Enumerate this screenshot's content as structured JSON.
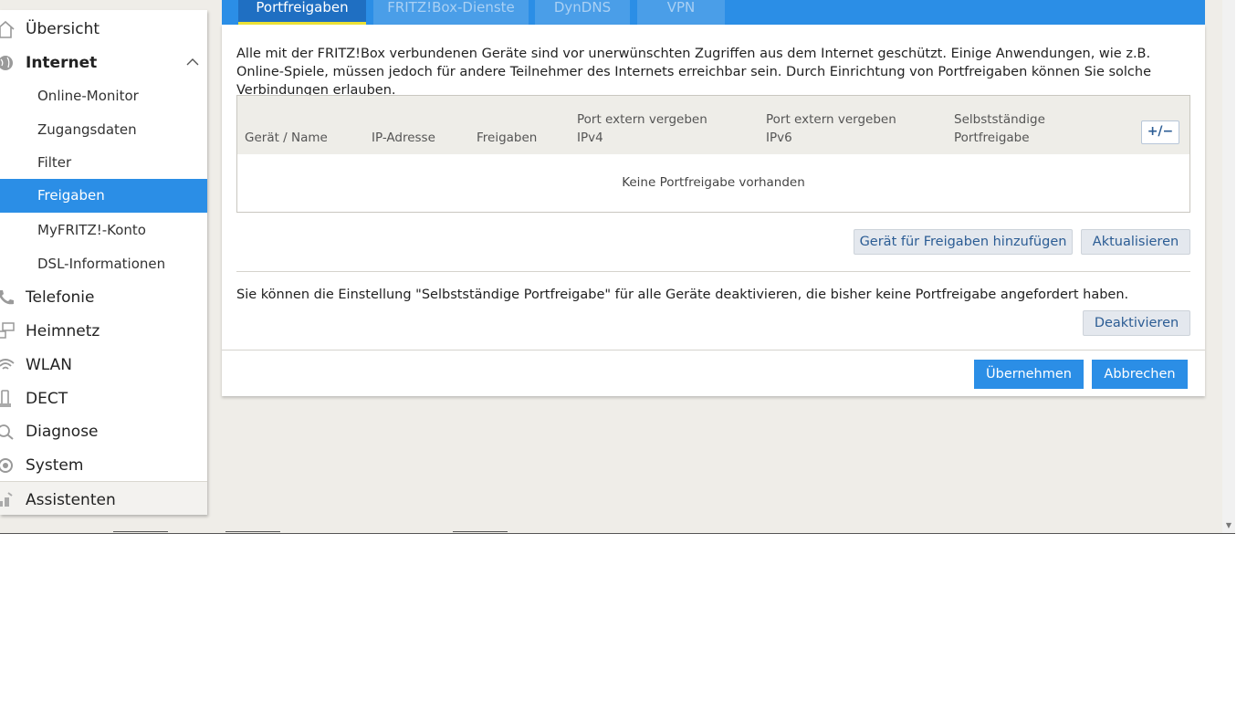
{
  "sidebar": {
    "items": [
      {
        "label": "Übersicht",
        "icon": "home-icon"
      },
      {
        "label": "Internet",
        "icon": "globe-icon",
        "expanded": true
      },
      {
        "label": "Online-Monitor"
      },
      {
        "label": "Zugangsdaten"
      },
      {
        "label": "Filter"
      },
      {
        "label": "Freigaben",
        "active": true
      },
      {
        "label": "MyFRITZ!-Konto"
      },
      {
        "label": "DSL-Informationen"
      },
      {
        "label": "Telefonie",
        "icon": "phone-icon"
      },
      {
        "label": "Heimnetz",
        "icon": "network-icon"
      },
      {
        "label": "WLAN",
        "icon": "wifi-icon"
      },
      {
        "label": "DECT",
        "icon": "dect-phone-icon"
      },
      {
        "label": "Diagnose",
        "icon": "diagnose-icon"
      },
      {
        "label": "System",
        "icon": "system-icon"
      },
      {
        "label": "Assistenten",
        "icon": "wizard-icon"
      }
    ]
  },
  "tabs": [
    {
      "label": "Portfreigaben",
      "active": true
    },
    {
      "label": "FRITZ!Box-Dienste"
    },
    {
      "label": "DynDNS"
    },
    {
      "label": "VPN"
    }
  ],
  "intro": "Alle mit der FRITZ!Box verbundenen Geräte sind vor unerwünschten Zugriffen aus dem Internet geschützt. Einige Anwendungen, wie z.B. Online-Spiele, müssen jedoch für andere Teilnehmer des Internets erreichbar sein. Durch Einrichtung von Portfreigaben können Sie solche Verbindungen erlauben.",
  "table": {
    "headers": [
      "Gerät / Name",
      "IP-Adresse",
      "Freigaben",
      "Port extern vergeben IPv4",
      "Port extern vergeben IPv6",
      "Selbstständige Portfreigabe"
    ],
    "header_lines": {
      "ipv4_1": "Port extern vergeben",
      "ipv4_2": "IPv4",
      "ipv6_1": "Port extern vergeben",
      "ipv6_2": "IPv6",
      "self_1": "Selbstständige",
      "self_2": "Portfreigabe"
    },
    "toggle_label": "+/−",
    "empty_text": "Keine Portfreigabe vorhanden"
  },
  "buttons": {
    "add_device": "Gerät für Freigaben hinzufügen",
    "refresh": "Aktualisieren",
    "deactivate": "Deaktivieren",
    "apply": "Übernehmen",
    "cancel": "Abbrechen"
  },
  "note": "Sie können die Einstellung \"Selbstständige Portfreigabe\" für alle Geräte deaktivieren, die bisher keine Portfreigabe angefordert haben.",
  "colors": {
    "accent": "#2b8ee6",
    "active_tab": "#1f6fc2",
    "tab_underline": "#ebe135",
    "background": "#efede8"
  }
}
